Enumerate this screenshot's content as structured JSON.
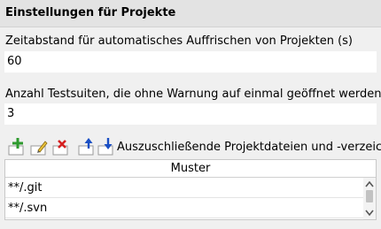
{
  "header": {
    "title": "Einstellungen für Projekte"
  },
  "refresh": {
    "label": "Zeitabstand für automatisches Auffrischen von Projekten (s)",
    "value": "60"
  },
  "testsuites": {
    "label": "Anzahl Testsuiten, die ohne Warnung auf einmal geöffnet werden",
    "value": "3"
  },
  "exclusions": {
    "label": "Auszuschließende Projektdateien und -verzeichnisse",
    "toolbar": {
      "icons": [
        "add-icon",
        "edit-icon",
        "delete-icon",
        "move-up-icon",
        "move-down-icon"
      ],
      "colors": {
        "add": "#2e9a2e",
        "delete": "#d62020",
        "arrow": "#1a4fc4"
      }
    },
    "table": {
      "columns": [
        "Muster"
      ],
      "rows": [
        "**/.git",
        "**/.svn"
      ]
    }
  }
}
